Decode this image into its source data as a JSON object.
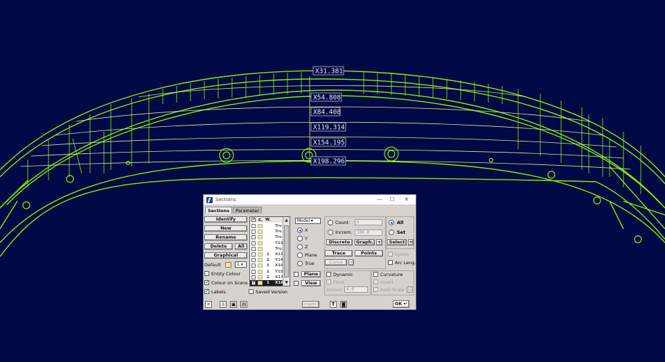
{
  "viewport": {
    "background_color": "#000846",
    "wireframe_color": "#7cf500",
    "section_line_color": "#e0f080",
    "section_labels": [
      "X31.381",
      "X54.808",
      "X84.408",
      "X119.314",
      "X154.195",
      "X198.296"
    ]
  },
  "dialog": {
    "title": "Sections",
    "tabs": [
      "Sections",
      "Parameter"
    ],
    "left": {
      "identify": "Identify",
      "new": "New",
      "rename": "Rename",
      "delete": "Delete",
      "all": "All",
      "graphical": "Graphical",
      "default_label": "Default",
      "default_width": "1",
      "entity_colour": "Entity Colour",
      "colour_on_scans": "Colour on Scans",
      "labels": "Labels",
      "saved_version": "Saved Version"
    },
    "list": {
      "headers": [
        "C.",
        "W."
      ],
      "rows": [
        {
          "w": "",
          "name": "Tru"
        },
        {
          "w": "",
          "name": "Tru"
        },
        {
          "w": "",
          "name": "Tru"
        },
        {
          "w": "",
          "name": "Y13"
        },
        {
          "w": "",
          "name": "Tru"
        },
        {
          "w": "1",
          "name": "X15"
        },
        {
          "w": "1",
          "name": "Y14"
        },
        {
          "w": "1",
          "name": "X16"
        },
        {
          "w": "1",
          "name": "Y15"
        },
        {
          "w": "1",
          "name": "X17"
        },
        {
          "w": "1",
          "name": "X18"
        }
      ]
    },
    "mode": {
      "dropdown": "Model",
      "x": "X",
      "y": "Y",
      "z": "Z",
      "plane": "Plane",
      "true": "True",
      "plane_btn": "Plane",
      "view_btn": "View"
    },
    "spacing": {
      "count": "Count",
      "count_value": "6",
      "increm": "Increm.",
      "increm_value": "100.0",
      "discrete": "Discrete",
      "graph": "Graph.",
      "plus": "+",
      "trace": "Trace",
      "points": "Points",
      "curve": "Curve"
    },
    "scope": {
      "all": "All",
      "set": "Set",
      "select": "Select",
      "plus": "+",
      "symm": "Symm",
      "arc_leng": "Arc Leng."
    },
    "dynamic": {
      "dynamic": "Dynamic",
      "point": "Point",
      "increm": "Increm.",
      "increm_value": "4.0"
    },
    "curvature": {
      "curvature": "Curvature",
      "invert": "Invert",
      "auto_scale": "Auto Scale"
    },
    "bottom": {
      "inspect": "Inspect",
      "ok": "OK ↵",
      "text_icon": "T"
    }
  }
}
